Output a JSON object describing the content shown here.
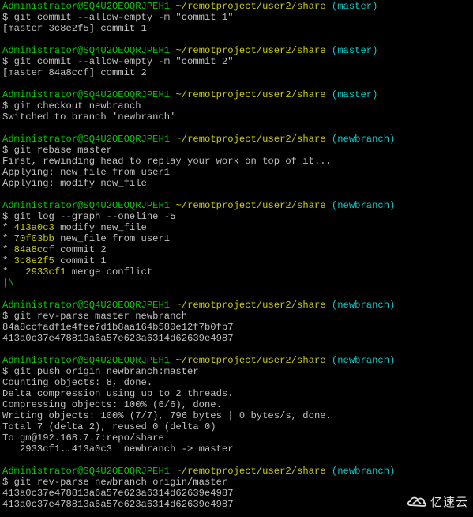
{
  "colors": {
    "background": "#000000",
    "prompt_user": "#00cd00",
    "prompt_path": "#cdcd00",
    "prompt_branch": "#00cdcd",
    "text": "#c0c0c0",
    "commit_hash": "#cdcd00",
    "graph_branch": "#00cd00"
  },
  "prompt": {
    "user_host": "Administrator@SQ4U2OEOQRJPEH1",
    "path": "~/remotproject/user2/share"
  },
  "blocks": [
    {
      "branch": "(master)",
      "command": "$ git commit --allow-empty -m \"commit 1\"",
      "output": [
        "[master 3c8e2f5] commit 1"
      ]
    },
    {
      "branch": "(master)",
      "command": "$ git commit --allow-empty -m \"commit 2\"",
      "output": [
        "[master 84a8ccf] commit 2"
      ]
    },
    {
      "branch": "(master)",
      "command": "$ git checkout newbranch",
      "output": [
        "Switched to branch 'newbranch'"
      ]
    },
    {
      "branch": "(newbranch)",
      "command": "$ git rebase master",
      "output": [
        "First, rewinding head to replay your work on top of it...",
        "Applying: new_file from user1",
        "Applying: modify new_file"
      ]
    }
  ],
  "log_block": {
    "branch": "(newbranch)",
    "command": "$ git log --graph --oneline -5",
    "entries": [
      {
        "graph": "* ",
        "hash": "413a0c3",
        "message": " modify new_file"
      },
      {
        "graph": "* ",
        "hash": "70f03bb",
        "message": " new_file from user1"
      },
      {
        "graph": "* ",
        "hash": "84a8ccf",
        "message": " commit 2"
      },
      {
        "graph": "* ",
        "hash": "3c8e2f5",
        "message": " commit 1"
      },
      {
        "graph": "*   ",
        "hash": "2933cf1",
        "message": " merge conflict"
      }
    ],
    "tail_graph": "|\\"
  },
  "blocks2": [
    {
      "branch": "(newbranch)",
      "command": "$ git rev-parse master newbranch",
      "output": [
        "84a8ccfadf1e4fee7d1b8aa164b580e12f7b0fb7",
        "413a0c37e478813a6a57e623a6314d62639e4987"
      ]
    },
    {
      "branch": "(newbranch)",
      "command": "$ git push origin newbranch:master",
      "output": [
        "Counting objects: 8, done.",
        "Delta compression using up to 2 threads.",
        "Compressing objects: 100% (6/6), done.",
        "Writing objects: 100% (7/7), 796 bytes | 0 bytes/s, done.",
        "Total 7 (delta 2), reused 0 (delta 0)",
        "To gm@192.168.7.7:repo/share",
        "   2933cf1..413a0c3  newbranch -> master"
      ]
    },
    {
      "branch": "(newbranch)",
      "command": "$ git rev-parse newbranch origin/master",
      "output": [
        "413a0c37e478813a6a57e623a6314d62639e4987",
        "413a0c37e478813a6a57e623a6314d62639e4987"
      ]
    }
  ],
  "watermark": {
    "text": "亿速云",
    "icon": "yisu-cloud-logo-icon"
  }
}
